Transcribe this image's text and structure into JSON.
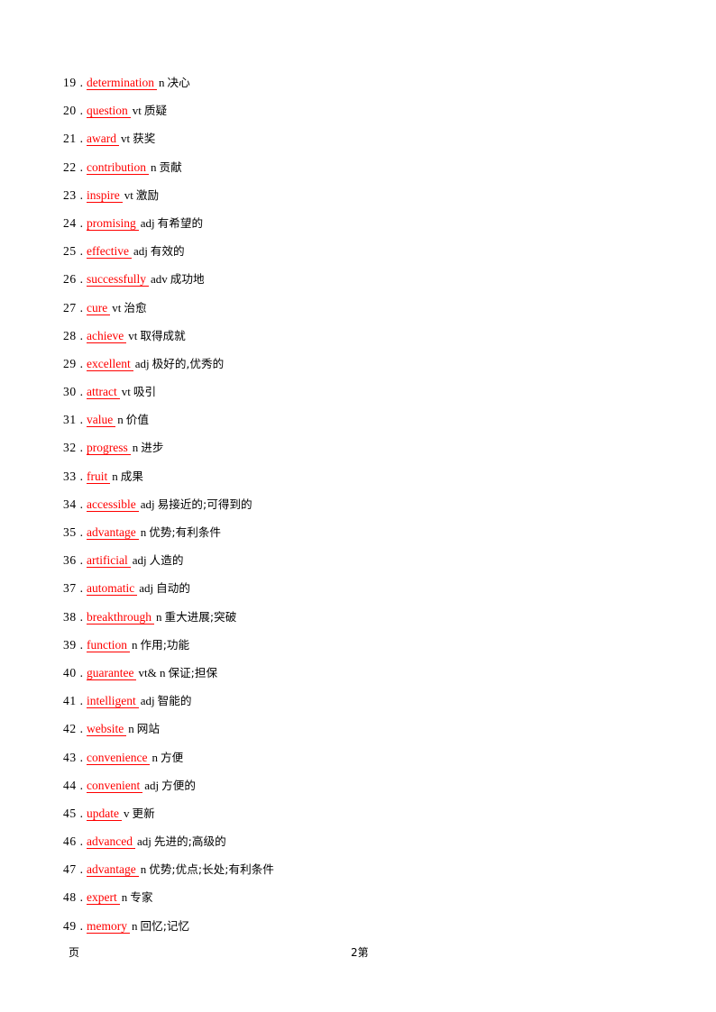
{
  "document": {
    "type": "vocabulary-list",
    "page_number_label": "2"
  },
  "vocab": {
    "items": [
      {
        "number": "19 .",
        "word": "determination",
        "pos": "n",
        "definition": "决心"
      },
      {
        "number": "20 .",
        "word": "question",
        "pos": "vt",
        "definition": "质疑"
      },
      {
        "number": "21 .",
        "word": "award",
        "pos": "vt",
        "definition": "获奖"
      },
      {
        "number": "22 .",
        "word": "contribution",
        "pos": "n",
        "definition": "贡献"
      },
      {
        "number": "23 .",
        "word": "inspire",
        "pos": "vt",
        "definition": "激励"
      },
      {
        "number": "24 .",
        "word": "promising",
        "pos": "adj",
        "definition": "有希望的"
      },
      {
        "number": "25 .",
        "word": "effective",
        "pos": "adj",
        "definition": "有效的"
      },
      {
        "number": "26 .",
        "word": "successfully",
        "pos": "adv",
        "definition": "成功地"
      },
      {
        "number": "27 .",
        "word": "cure",
        "pos": "vt",
        "definition": "治愈"
      },
      {
        "number": "28 .",
        "word": "achieve",
        "pos": "vt",
        "definition": "取得成就"
      },
      {
        "number": "29 .",
        "word": "excellent",
        "pos": "adj",
        "definition": "极好的,优秀的"
      },
      {
        "number": "30 .",
        "word": "attract",
        "pos": "vt",
        "definition": "吸引"
      },
      {
        "number": "31 .",
        "word": "value",
        "pos": "n",
        "definition": "价值"
      },
      {
        "number": "32 .",
        "word": "progress",
        "pos": "n",
        "definition": "进步"
      },
      {
        "number": "33 .",
        "word": "fruit",
        "pos": "n",
        "definition": "成果"
      },
      {
        "number": "34 .",
        "word": "accessible",
        "pos": "adj",
        "definition": "易接近的;可得到的"
      },
      {
        "number": "35 .",
        "word": "advantage",
        "pos": "n",
        "definition": "优势;有利条件"
      },
      {
        "number": "36 .",
        "word": "artificial",
        "pos": "adj",
        "definition": "人造的"
      },
      {
        "number": "37 .",
        "word": "automatic",
        "pos": "adj",
        "definition": "自动的"
      },
      {
        "number": "38 .",
        "word": "breakthrough",
        "pos": "n",
        "definition": "重大进展;突破"
      },
      {
        "number": "39 .",
        "word": "function",
        "pos": "n",
        "definition": "作用;功能"
      },
      {
        "number": "40 .",
        "word": "guarantee",
        "pos": "vt& n",
        "definition": "保证;担保"
      },
      {
        "number": "41 .",
        "word": "intelligent",
        "pos": "adj",
        "definition": "智能的"
      },
      {
        "number": "42 .",
        "word": "website",
        "pos": "n",
        "definition": "网站"
      },
      {
        "number": "43 .",
        "word": "convenience",
        "pos": "n",
        "definition": "方便"
      },
      {
        "number": "44 .",
        "word": "convenient",
        "pos": "adj",
        "definition": "方便的"
      },
      {
        "number": "45 .",
        "word": "update",
        "pos": "v",
        "definition": "更新"
      },
      {
        "number": "46 .",
        "word": "advanced",
        "pos": "adj",
        "definition": "先进的;高级的"
      },
      {
        "number": "47 .",
        "word": "advantage",
        "pos": "n",
        "definition": "优势;优点;长处;有利条件"
      },
      {
        "number": "48 .",
        "word": "expert",
        "pos": "n",
        "definition": "专家"
      },
      {
        "number": "49 .",
        "word": "memory",
        "pos": "n",
        "definition": "回忆;记忆"
      }
    ]
  },
  "footer": {
    "left_text": "页",
    "center_text": "2第"
  }
}
